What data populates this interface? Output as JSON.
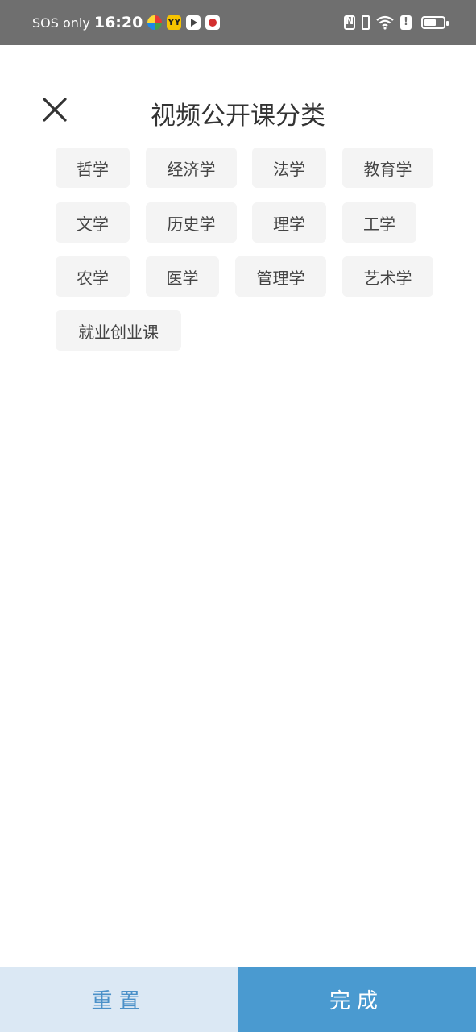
{
  "status_bar": {
    "carrier": "SOS only",
    "time": "16:20",
    "app_icons": [
      "chrome-like-icon",
      "yy-app-icon",
      "play-icon",
      "red-dot-app-icon"
    ],
    "app_badge_text": "YY",
    "alert_text": "!",
    "right_icons": [
      "nfc-icon",
      "vibrate-icon",
      "wifi-icon",
      "alert-icon",
      "battery-icon"
    ],
    "battery_level": 0.7
  },
  "header": {
    "title": "视频公开课分类",
    "close_icon": "close-icon"
  },
  "categories": [
    "哲学",
    "经济学",
    "法学",
    "教育学",
    "文学",
    "历史学",
    "理学",
    "工学",
    "农学",
    "医学",
    "管理学",
    "艺术学",
    "就业创业课"
  ],
  "footer": {
    "reset_label": "重置",
    "done_label": "完成"
  },
  "colors": {
    "status_bar_bg": "#6f6f6f",
    "tag_bg": "#f4f4f4",
    "reset_bg": "#dbe8f4",
    "reset_text": "#4a90c8",
    "done_bg": "#4a9ad0"
  }
}
